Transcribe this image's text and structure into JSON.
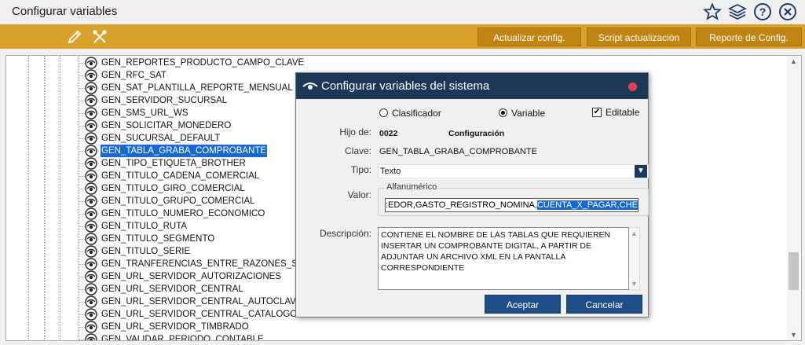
{
  "window": {
    "title": "Configurar variables"
  },
  "title_icons": [
    "star-icon",
    "layers-icon",
    "help-icon",
    "close-icon"
  ],
  "toolbar": {
    "icons": [
      "pencil-icon",
      "tools-icon"
    ],
    "buttons": [
      "Actualizar config.",
      "Script actualización",
      "Reporte de Config."
    ]
  },
  "tree": {
    "items": [
      "GEN_REPORTES_PRODUCTO_CAMPO_CLAVE",
      "GEN_RFC_SAT",
      "GEN_SAT_PLANTILLA_REPORTE_MENSUAL",
      "GEN_SERVIDOR_SUCURSAL",
      "GEN_SMS_URL_WS",
      "GEN_SOLICITAR_MONEDERO",
      "GEN_SUCURSAL_DEFAULT",
      "GEN_TABLA_GRABA_COMPROBANTE",
      "GEN_TIPO_ETIQUETA_BROTHER",
      "GEN_TITULO_CADENA_COMERCIAL",
      "GEN_TITULO_GIRO_COMERCIAL",
      "GEN_TITULO_GRUPO_COMERCIAL",
      "GEN_TITULO_NUMERO_ECONOMICO",
      "GEN_TITULO_RUTA",
      "GEN_TITULO_SEGMENTO",
      "GEN_TITULO_SERIE",
      "GEN_TRANFERENCIAS_ENTRE_RAZONES_SOCIALES",
      "GEN_URL_SERVIDOR_AUTORIZACIONES",
      "GEN_URL_SERVIDOR_CENTRAL",
      "GEN_URL_SERVIDOR_CENTRAL_AUTOCLAVE",
      "GEN_URL_SERVIDOR_CENTRAL_CATALOGO",
      "GEN_URL_SERVIDOR_TIMBRADO",
      "GEN_VALIDAR_PERIODO_CONTABLE"
    ],
    "selected_index": 7
  },
  "dialog": {
    "title": "Configurar variables del sistema",
    "radio_clasificador": "Clasificador",
    "radio_variable": "Variable",
    "selected_radio": "Variable",
    "editable_label": "Editable",
    "editable_checked": true,
    "hijo_de_label": "Hijo de:",
    "hijo_de_code": "0022",
    "hijo_de_name": "Configuración",
    "clave_label": "Clave:",
    "clave_value": "GEN_TABLA_GRABA_COMPROBANTE",
    "tipo_label": "Tipo:",
    "tipo_value": "Texto",
    "valor_label": "Valor:",
    "valor_group": "Alfanumérico",
    "valor_text_plain": ":EDOR,GASTO_REGISTRO_NOMINA,",
    "valor_text_selected": "CUENTA_X_PAGAR,CHEQUE",
    "descripcion_label": "Descripción:",
    "descripcion_value": "CONTIENE EL NOMBRE DE LAS TABLAS QUE REQUIEREN INSERTAR UN COMPROBANTE DIGITAL, A PARTIR DE ADJUNTAR UN ARCHIVO XML EN LA PANTALLA CORRESPONDIENTE",
    "aceptar": "Aceptar",
    "cancelar": "Cancelar"
  },
  "colors": {
    "toolbar": "#d8a12a",
    "dialog_header": "#1b3859",
    "selection": "#1769d1",
    "primary_button": "#1d4e8a"
  }
}
